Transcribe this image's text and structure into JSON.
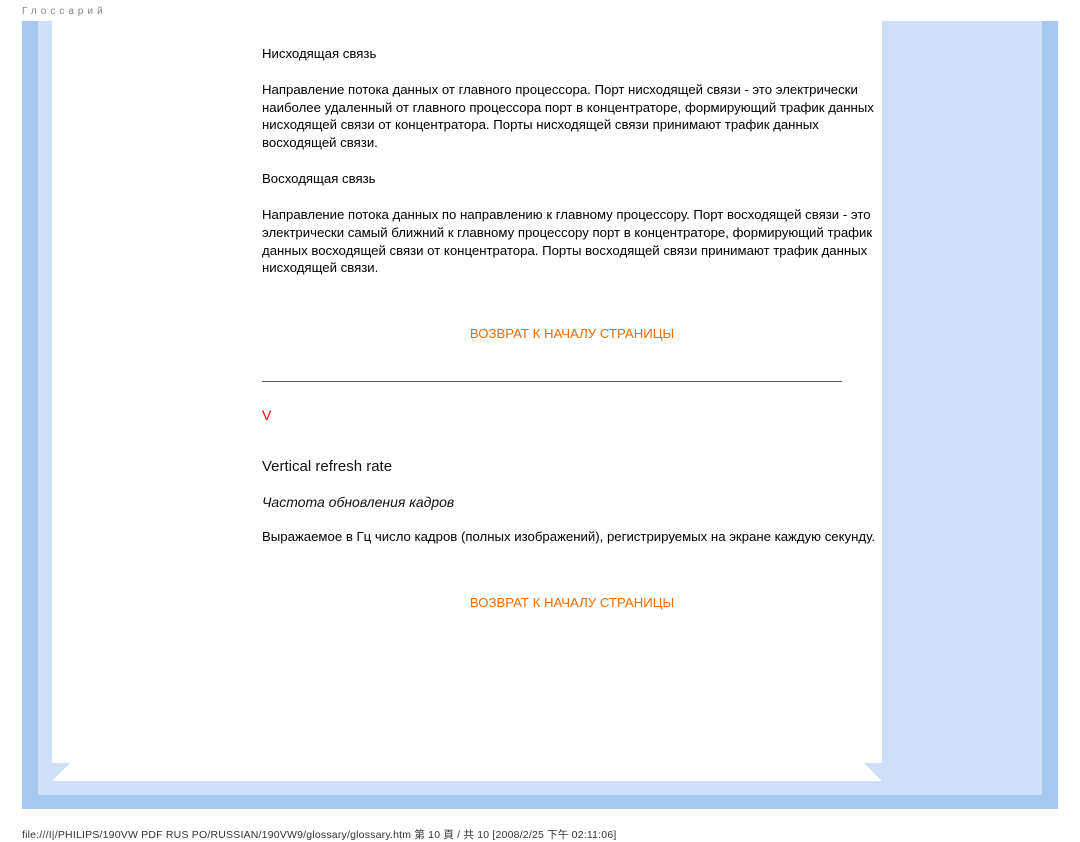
{
  "header": {
    "title": "Глоссарий"
  },
  "content": {
    "downstream": {
      "title": "Нисходящая связь",
      "body": "Направление потока данных от главного процессора. Порт нисходящей связи - это электрически наиболее удаленный от главного процессора порт в концентраторе, формирующий трафик данных нисходящей связи от концентратора. Порты нисходящей связи принимают трафик данных восходящей связи."
    },
    "upstream": {
      "title": "Восходящая связь",
      "body": "Направление потока данных по направлению к главному процессору. Порт восходящей связи - это электрически самый ближний к главному процессору порт в концентраторе, формирующий трафик данных восходящей связи от концентратора. Порты восходящей связи принимают трафик данных нисходящей связи."
    },
    "back_to_top": "ВОЗВРАТ К НАЧАЛУ СТРАНИЦЫ",
    "letter": "V",
    "term_english": "Vertical refresh rate",
    "term_russian_italic": "Частота обновления кадров",
    "term_desc": "Выражаемое в Гц число кадров (полных изображений), регистрируемых на экране каждую секунду."
  },
  "footer": {
    "path": "file:///I|/PHILIPS/190VW PDF RUS PO/RUSSIAN/190VW9/glossary/glossary.htm 第 10 頁 / 共 10  [2008/2/25 下午 02:11:06]"
  }
}
